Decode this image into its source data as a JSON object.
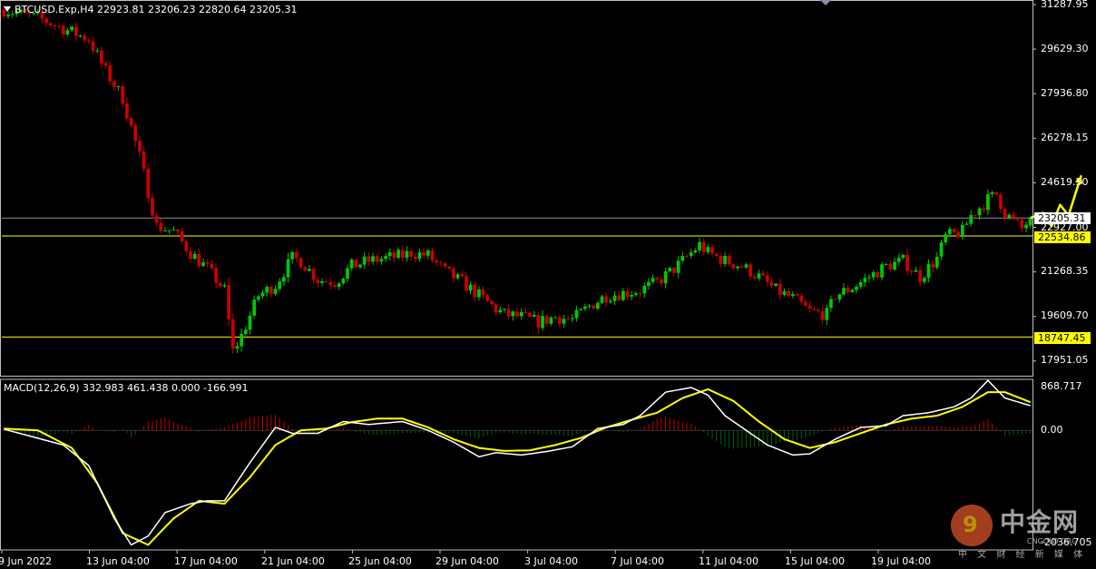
{
  "symbol_header": "BTCUSD.Exp,H4  22923.81 23206.23 22820.64 23205.31",
  "macd_header": "MACD(12,26,9) 332.983 461.438 0.000 -166.991",
  "colors": {
    "background": "#000000",
    "bull_candle": "#00c800",
    "bear_candle": "#c80000",
    "macd_line": "#ffffff",
    "signal_line": "#ffff00",
    "hist_pos": "#c80000",
    "hist_neg": "#006400",
    "level_line": "#ffff00",
    "price_line": "#8c8caa",
    "arrow": "#ffff00"
  },
  "price_axis": {
    "labels": [
      "31287.95",
      "29629.30",
      "27936.80",
      "26278.15",
      "24619.50",
      "22927.00",
      "21268.35",
      "19609.70",
      "17951.05"
    ],
    "current_price": "23205.31",
    "levels": [
      "22534.86",
      "18747.45"
    ]
  },
  "macd_axis": {
    "labels": [
      "868.717",
      "0.00",
      "-2036.705"
    ]
  },
  "time_axis": [
    "9 Jun 2022",
    "13 Jun 04:00",
    "17 Jun 04:00",
    "21 Jun 04:00",
    "25 Jun 04:00",
    "29 Jun 04:00",
    "3 Jul 04:00",
    "7 Jul 04:00",
    "11 Jul 04:00",
    "15 Jul 04:00",
    "19 Jul 04:00"
  ],
  "watermark": {
    "name": "中金网",
    "domain": "CNGOLD.ORG",
    "tagline": "中 文 财 经 新 媒 体"
  },
  "chart_data": {
    "type": "candlestick",
    "symbol": "BTCUSD.Exp",
    "timeframe": "H4",
    "ohlc_last": {
      "open": 22923.81,
      "high": 23206.23,
      "low": 22820.64,
      "close": 23205.31
    },
    "ylim": [
      17300,
      31300
    ],
    "close_path_knots": [
      [
        0,
        31000
      ],
      [
        8,
        30700
      ],
      [
        14,
        30300
      ],
      [
        20,
        29900
      ],
      [
        24,
        28700
      ],
      [
        28,
        27700
      ],
      [
        32,
        25500
      ],
      [
        36,
        22900
      ],
      [
        40,
        22700
      ],
      [
        44,
        21900
      ],
      [
        48,
        21300
      ],
      [
        52,
        20500
      ],
      [
        54,
        18200
      ],
      [
        56,
        18800
      ],
      [
        60,
        20300
      ],
      [
        64,
        20700
      ],
      [
        68,
        21700
      ],
      [
        70,
        21600
      ],
      [
        74,
        20900
      ],
      [
        78,
        20800
      ],
      [
        82,
        21400
      ],
      [
        86,
        21600
      ],
      [
        90,
        21700
      ],
      [
        94,
        21800
      ],
      [
        96,
        21900
      ],
      [
        100,
        21800
      ],
      [
        104,
        21200
      ],
      [
        108,
        20800
      ],
      [
        112,
        20300
      ],
      [
        116,
        19800
      ],
      [
        118,
        19600
      ],
      [
        122,
        19500
      ],
      [
        126,
        19300
      ],
      [
        130,
        19500
      ],
      [
        134,
        19400
      ],
      [
        138,
        19900
      ],
      [
        142,
        20300
      ],
      [
        146,
        20400
      ],
      [
        150,
        20500
      ],
      [
        154,
        20800
      ],
      [
        158,
        21300
      ],
      [
        162,
        21900
      ],
      [
        164,
        22200
      ],
      [
        166,
        21900
      ],
      [
        170,
        21600
      ],
      [
        174,
        21400
      ],
      [
        178,
        21000
      ],
      [
        182,
        20500
      ],
      [
        186,
        20200
      ],
      [
        190,
        19700
      ],
      [
        194,
        19600
      ],
      [
        196,
        20300
      ],
      [
        200,
        20600
      ],
      [
        204,
        21000
      ],
      [
        208,
        21400
      ],
      [
        212,
        21600
      ],
      [
        216,
        21000
      ],
      [
        220,
        21700
      ],
      [
        222,
        22500
      ],
      [
        226,
        22700
      ],
      [
        228,
        23300
      ],
      [
        232,
        23900
      ],
      [
        234,
        24100
      ],
      [
        236,
        23400
      ],
      [
        240,
        22800
      ],
      [
        242,
        23205
      ]
    ],
    "macd_line_knots": [
      [
        0,
        20
      ],
      [
        14,
        -250
      ],
      [
        20,
        -600
      ],
      [
        26,
        -1500
      ],
      [
        30,
        -1950
      ],
      [
        34,
        -1800
      ],
      [
        38,
        -1400
      ],
      [
        44,
        -1250
      ],
      [
        48,
        -1200
      ],
      [
        52,
        -1200
      ],
      [
        58,
        -550
      ],
      [
        64,
        50
      ],
      [
        68,
        -50
      ],
      [
        74,
        -50
      ],
      [
        80,
        150
      ],
      [
        86,
        100
      ],
      [
        94,
        150
      ],
      [
        100,
        0
      ],
      [
        106,
        -200
      ],
      [
        112,
        -450
      ],
      [
        116,
        -380
      ],
      [
        122,
        -420
      ],
      [
        128,
        -360
      ],
      [
        134,
        -280
      ],
      [
        140,
        30
      ],
      [
        146,
        100
      ],
      [
        150,
        250
      ],
      [
        156,
        650
      ],
      [
        162,
        730
      ],
      [
        166,
        600
      ],
      [
        170,
        250
      ],
      [
        176,
        -50
      ],
      [
        180,
        -250
      ],
      [
        186,
        -420
      ],
      [
        190,
        -400
      ],
      [
        196,
        -150
      ],
      [
        202,
        50
      ],
      [
        208,
        80
      ],
      [
        212,
        250
      ],
      [
        218,
        300
      ],
      [
        224,
        400
      ],
      [
        228,
        550
      ],
      [
        232,
        850
      ],
      [
        236,
        550
      ],
      [
        242,
        420
      ]
    ],
    "signal_line_knots": [
      [
        0,
        30
      ],
      [
        8,
        0
      ],
      [
        16,
        -300
      ],
      [
        22,
        -900
      ],
      [
        28,
        -1750
      ],
      [
        34,
        -1950
      ],
      [
        40,
        -1500
      ],
      [
        46,
        -1200
      ],
      [
        52,
        -1250
      ],
      [
        58,
        -800
      ],
      [
        64,
        -250
      ],
      [
        70,
        0
      ],
      [
        76,
        30
      ],
      [
        82,
        140
      ],
      [
        88,
        200
      ],
      [
        94,
        200
      ],
      [
        100,
        50
      ],
      [
        106,
        -150
      ],
      [
        112,
        -300
      ],
      [
        118,
        -350
      ],
      [
        124,
        -340
      ],
      [
        130,
        -250
      ],
      [
        136,
        -130
      ],
      [
        142,
        50
      ],
      [
        148,
        180
      ],
      [
        154,
        300
      ],
      [
        160,
        550
      ],
      [
        166,
        700
      ],
      [
        172,
        500
      ],
      [
        178,
        150
      ],
      [
        184,
        -150
      ],
      [
        190,
        -300
      ],
      [
        196,
        -200
      ],
      [
        202,
        -50
      ],
      [
        208,
        100
      ],
      [
        214,
        200
      ],
      [
        220,
        250
      ],
      [
        226,
        400
      ],
      [
        232,
        650
      ],
      [
        236,
        650
      ],
      [
        242,
        480
      ]
    ],
    "macd_ylim": [
      -2036.705,
      868.717
    ],
    "levels": [
      22534.86,
      18747.45
    ],
    "current_price": 23205.31,
    "projection_arrow_knots": [
      [
        242,
        23205
      ],
      [
        245,
        23400
      ],
      [
        247,
        22900
      ],
      [
        249,
        23700
      ],
      [
        251,
        23300
      ],
      [
        254,
        24800
      ]
    ]
  }
}
